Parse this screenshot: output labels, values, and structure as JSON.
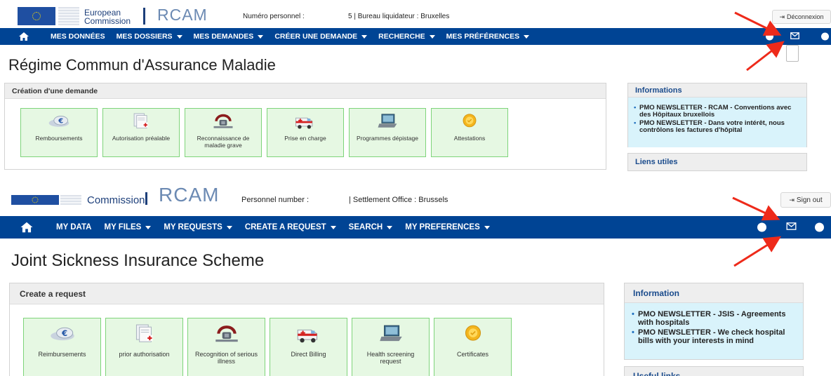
{
  "colors": {
    "nav_blue": "#004494",
    "tile_bg": "#e6f8e3",
    "tile_border": "#7ed47a",
    "info_bg": "#d9f3fb",
    "arrow_red": "#ee2a1a"
  },
  "fr": {
    "logo": {
      "line1": "European",
      "line2": "Commission",
      "app": "RCAM"
    },
    "personnel_label": "Numéro personnel :",
    "office": "5 | Bureau liquidateur : Bruxelles",
    "logout": "Déconnexion",
    "nav": [
      {
        "label": "MES DONNÉES",
        "caret": false
      },
      {
        "label": "MES DOSSIERS",
        "caret": true
      },
      {
        "label": "MES DEMANDES",
        "caret": true
      },
      {
        "label": "CRÉER UNE DEMANDE",
        "caret": true
      },
      {
        "label": "RECHERCHE",
        "caret": true
      },
      {
        "label": "MES PRÉFÉRENCES",
        "caret": true
      }
    ],
    "title": "Régime Commun d'Assurance Maladie",
    "create_header": "Création d'une demande",
    "tiles": [
      "Remboursements",
      "Autorisation préalable",
      "Reconnaissance de maladie grave",
      "Prise en charge",
      "Programmes dépistage",
      "Attestations"
    ],
    "info_header": "Informations",
    "info_items": [
      "PMO NEWSLETTER - RCAM - Conventions avec des Hôpitaux bruxellois",
      "PMO NEWSLETTER - Dans votre intérêt, nous contrôlons les factures d'hôpital"
    ],
    "links_header": "Liens utiles"
  },
  "en": {
    "logo": {
      "line2": "Commission",
      "app": "RCAM"
    },
    "personnel_label": "Personnel number :",
    "office": "| Settlement Office : Brussels",
    "logout": "Sign out",
    "nav": [
      {
        "label": "MY DATA",
        "caret": false
      },
      {
        "label": "MY FILES",
        "caret": true
      },
      {
        "label": "MY REQUESTS",
        "caret": true
      },
      {
        "label": "CREATE A REQUEST",
        "caret": true
      },
      {
        "label": "SEARCH",
        "caret": true
      },
      {
        "label": "MY PREFERENCES",
        "caret": true
      }
    ],
    "title": "Joint Sickness Insurance Scheme",
    "create_header": "Create a request",
    "tiles": [
      "Reimbursements",
      "prior authorisation",
      "Recognition of serious illness",
      "Direct Billing",
      "Health screening request",
      "Certificates"
    ],
    "info_header": "Information",
    "info_items": [
      "PMO NEWSLETTER - JSIS - Agreements with hospitals",
      "PMO NEWSLETTER - We check hospital bills with your interests in mind"
    ],
    "links_header": "Useful links"
  },
  "icons": [
    "euro-coins-icon",
    "prescription-document-icon",
    "stethoscope-icon",
    "ambulance-icon",
    "laptop-icon",
    "certificate-seal-icon"
  ]
}
